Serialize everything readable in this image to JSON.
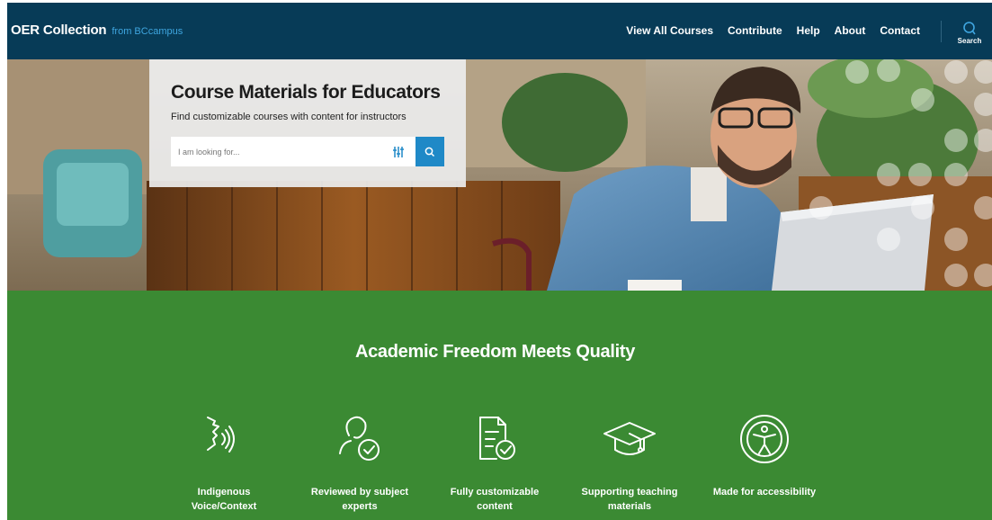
{
  "header": {
    "brand_name": "OER Collection",
    "brand_sub": "from BCcampus",
    "nav": [
      "View All Courses",
      "Contribute",
      "Help",
      "About",
      "Contact"
    ],
    "search_label": "Search"
  },
  "hero": {
    "title": "Course Materials for Educators",
    "subtitle": "Find customizable courses with content for instructors",
    "search_placeholder": "I am looking for...",
    "filter_icon": "sliders-icon",
    "search_icon": "magnifier-icon"
  },
  "features": {
    "title": "Academic Freedom Meets Quality",
    "items": [
      {
        "label": "Indigenous Voice/Context",
        "line1": "Indigenous",
        "line2": "Voice/Context",
        "icon": "speaking-head-icon"
      },
      {
        "label": "Reviewed by subject experts",
        "line1": "Reviewed by subject",
        "line2": "experts",
        "icon": "person-check-icon"
      },
      {
        "label": "Fully customizable content",
        "line1": "Fully customizable",
        "line2": "content",
        "icon": "document-check-icon"
      },
      {
        "label": "Supporting teaching materials",
        "line1": "Supporting teaching",
        "line2": "materials",
        "icon": "graduation-cap-icon"
      },
      {
        "label": "Made for accessibility",
        "line1": "Made for accessibility",
        "line2": "",
        "icon": "accessibility-icon"
      }
    ]
  },
  "colors": {
    "header_bg": "#073b57",
    "brand_accent": "#3fa6e0",
    "search_button": "#1f89c7",
    "features_bg": "#3b8a33"
  }
}
